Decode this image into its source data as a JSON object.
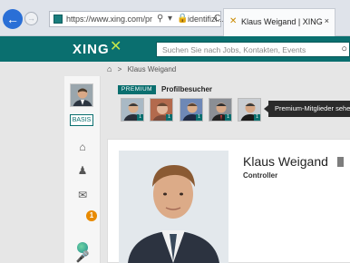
{
  "browser": {
    "url": "https://www.xing.com/pr",
    "identity_label": "identifizi...",
    "tab_title": "Klaus Weigand | XING",
    "tab_close": "×",
    "back_glyph": "←",
    "forward_glyph": "→",
    "search_glyph": "⚲",
    "refresh_glyph": "C"
  },
  "header": {
    "logo_text": "XING",
    "logo_mark": "✕",
    "search_placeholder": "Suchen Sie nach Jobs, Kontakten, Events",
    "brand_color": "#0a6f6f"
  },
  "breadcrumb": {
    "home_glyph": "⌂",
    "separator": ">",
    "current": "Klaus Weigand"
  },
  "sidebar": {
    "membership": "BASIS",
    "notification_count": "1",
    "icons": [
      "home-icon",
      "contacts-icon",
      "messages-icon",
      "globe-icon",
      "microphone-icon"
    ]
  },
  "visitors": {
    "badge": "PREMIUM",
    "title": "Profilbesucher",
    "counts": [
      "1",
      "1",
      "1",
      "1",
      "1"
    ],
    "tooltip": "Premium-Mitglieder sehen"
  },
  "profile": {
    "name": "Klaus Weigand",
    "role": "Controller"
  }
}
